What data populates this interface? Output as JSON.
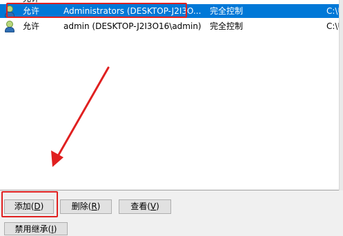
{
  "window": {
    "title": ""
  },
  "permission_list": {
    "rows": [
      {
        "icon": "user-icon",
        "type": "允许",
        "principal": "Administrators (DESKTOP-J2I3O...",
        "access": "完全控制",
        "inherited_from": "C:\\U",
        "selected": true
      },
      {
        "icon": "user-icon",
        "type": "允许",
        "principal": "admin (DESKTOP-J2I3O16\\admin)",
        "access": "完全控制",
        "inherited_from": "C:\\U",
        "selected": false
      }
    ],
    "partial_top_row": {
      "type": "允许"
    }
  },
  "buttons": {
    "add": {
      "label": "添加(",
      "key": "D",
      "suffix": ")"
    },
    "remove": {
      "label": "删除(",
      "key": "R",
      "suffix": ")"
    },
    "view": {
      "label": "查看(",
      "key": "V",
      "suffix": ")"
    },
    "disable_inheritance": {
      "label": "禁用继承(",
      "key": "I",
      "suffix": ")"
    }
  },
  "annotations": {
    "highlight_color": "#e02020",
    "selection_color": "#0078d7"
  }
}
